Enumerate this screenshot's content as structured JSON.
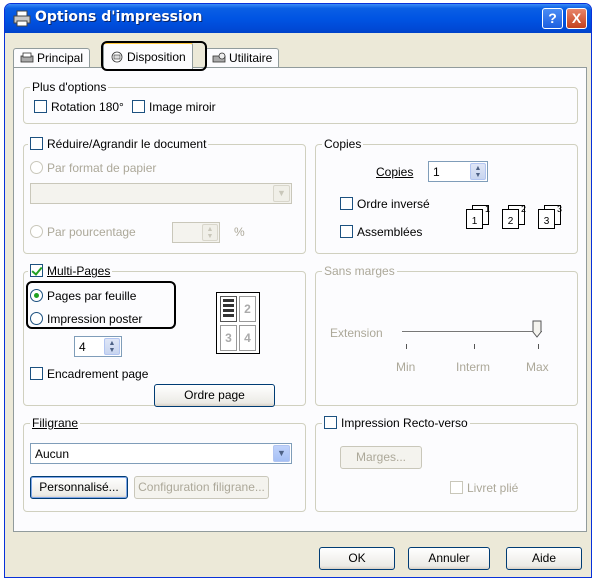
{
  "window": {
    "title": "Options d'impression",
    "help_btn": "?",
    "close_btn": "X"
  },
  "tabs": [
    {
      "label": "Principal",
      "icon": "printer-icon"
    },
    {
      "label": "Disposition",
      "icon": "layout-icon"
    },
    {
      "label": "Utilitaire",
      "icon": "utility-icon"
    }
  ],
  "plus_options": {
    "legend": "Plus d'options",
    "rotation": "Rotation 180°",
    "mirror": "Image miroir"
  },
  "reduce": {
    "legend": "Réduire/Agrandir le document",
    "by_paper": "Par format de papier",
    "by_percent": "Par pourcentage",
    "percent_sign": "%"
  },
  "copies": {
    "legend": "Copies",
    "label": "Copies",
    "value": "1",
    "reverse": "Ordre inversé",
    "collate": "Assemblées",
    "page_nums": [
      "1",
      "1",
      "2",
      "2",
      "3",
      "3"
    ]
  },
  "multipages": {
    "legend": "Multi-Pages",
    "pages_per_sheet": "Pages par feuille",
    "poster": "Impression poster",
    "count": "4",
    "frame": "Encadrement page",
    "order_btn": "Ordre page",
    "preview_nums": [
      "2",
      "3",
      "4"
    ]
  },
  "borderless": {
    "legend": "Sans marges",
    "extension": "Extension",
    "min": "Min",
    "mid": "Interm",
    "max": "Max",
    "level": 1.0
  },
  "watermark": {
    "legend": "Filigrane",
    "selected": "Aucun",
    "custom_btn": "Personnalisé...",
    "config_btn": "Configuration filigrane..."
  },
  "duplex": {
    "legend": "Impression Recto-verso",
    "margins_btn": "Marges...",
    "booklet": "Livret plié"
  },
  "footer": {
    "ok": "OK",
    "cancel": "Annuler",
    "help": "Aide"
  }
}
